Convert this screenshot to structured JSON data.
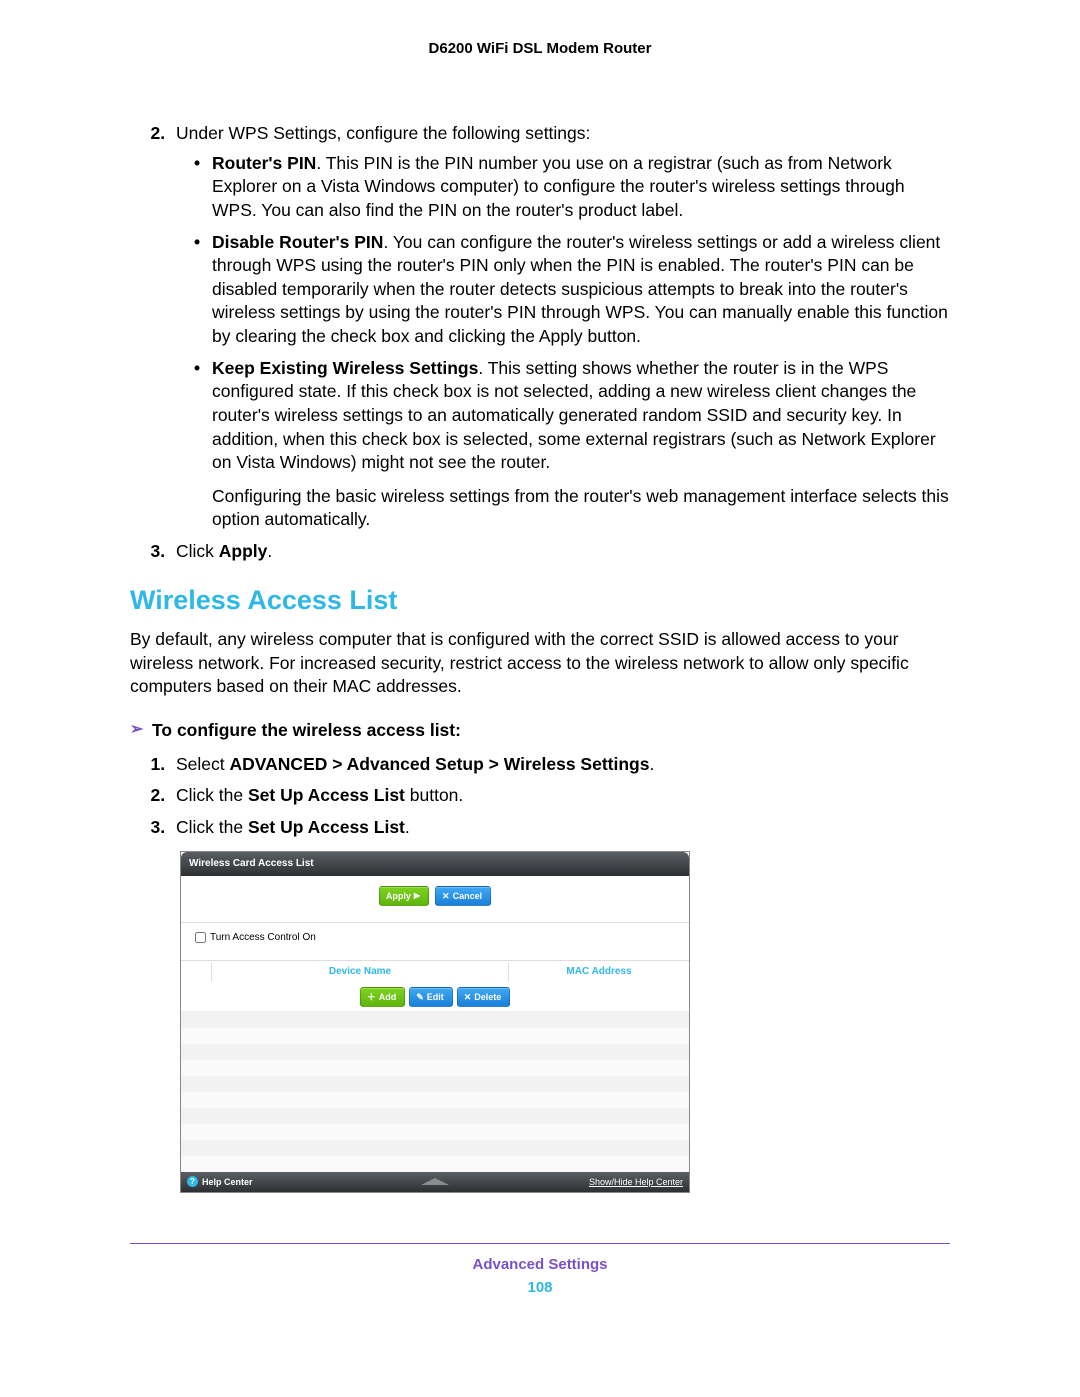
{
  "header": {
    "product": "D6200 WiFi DSL Modem Router"
  },
  "steps_top": {
    "s2_intro": "Under WPS Settings, configure the following settings:",
    "bullets": [
      {
        "term": "Router's PIN",
        "text": ". This PIN is the PIN number you use on a registrar (such as from Network Explorer on a Vista Windows computer) to configure the router's wireless settings through WPS. You can also find the PIN on the router's product label."
      },
      {
        "term": "Disable Router's PIN",
        "text": ". You can configure the router's wireless settings or add a wireless client through WPS using the router's PIN only when the PIN is enabled. The router's PIN can be disabled temporarily when the router detects suspicious attempts to break into the router's wireless settings by using the router's PIN through WPS. You can manually enable this function by clearing the check box and clicking the Apply button."
      },
      {
        "term": "Keep Existing Wireless Settings",
        "text": ". This setting shows whether the router is in the WPS configured state. If this check box is not selected, adding a new wireless client changes the router's wireless settings to an automatically generated random SSID and security key. In addition, when this check box is selected, some external registrars (such as Network Explorer on Vista Windows) might not see the router."
      }
    ],
    "tail_para": "Configuring the basic wireless settings from the router's web management interface selects this option automatically.",
    "s3_pre": "Click ",
    "s3_bold": "Apply",
    "s3_post": "."
  },
  "section": {
    "title": "Wireless Access List",
    "intro": "By default, any wireless computer that is configured with the correct SSID is allowed access to your wireless network. For increased security, restrict access to the wireless network to allow only specific computers based on their MAC addresses.",
    "proc_head": "To configure the wireless access list:",
    "steps": [
      {
        "pre": "Select ",
        "bold": "ADVANCED > Advanced Setup > Wireless Settings",
        "post": "."
      },
      {
        "pre": "Click the ",
        "bold": "Set Up Access List",
        "post": " button."
      },
      {
        "pre": "Click the ",
        "bold": "Set Up Access List",
        "post": "."
      }
    ]
  },
  "screenshot": {
    "title": "Wireless Card Access List",
    "apply": "Apply ",
    "cancel": "Cancel",
    "checkbox": "Turn Access Control On",
    "col_device": "Device Name",
    "col_mac": "MAC Address",
    "add": "Add",
    "edit": "Edit",
    "delete": "Delete",
    "help": "Help Center",
    "showhide": "Show/Hide Help Center"
  },
  "footer": {
    "section": "Advanced Settings",
    "page": "108"
  }
}
